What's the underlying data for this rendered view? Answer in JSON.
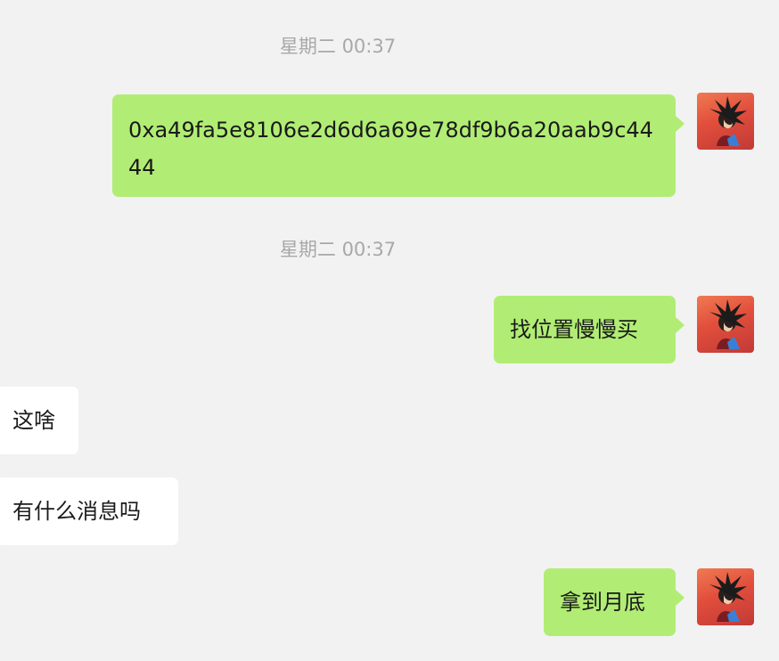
{
  "messages": [
    {
      "type": "timestamp",
      "text": "星期二 00:37"
    },
    {
      "type": "sent",
      "text": "0xa49fa5e8106e2d6d6a69e78df9b6a20aab9c4444"
    },
    {
      "type": "timestamp",
      "text": "星期二 00:37"
    },
    {
      "type": "sent",
      "text": "找位置慢慢买"
    },
    {
      "type": "received",
      "text": "这啥"
    },
    {
      "type": "received",
      "text": "有什么消息吗"
    },
    {
      "type": "sent",
      "text": "拿到月底"
    }
  ],
  "avatar_icon": "user-avatar-anime-character",
  "colors": {
    "background": "#f2f2f2",
    "sent_bubble": "#b1ed74",
    "received_bubble": "#ffffff",
    "timestamp_text": "#a8a8a8"
  }
}
